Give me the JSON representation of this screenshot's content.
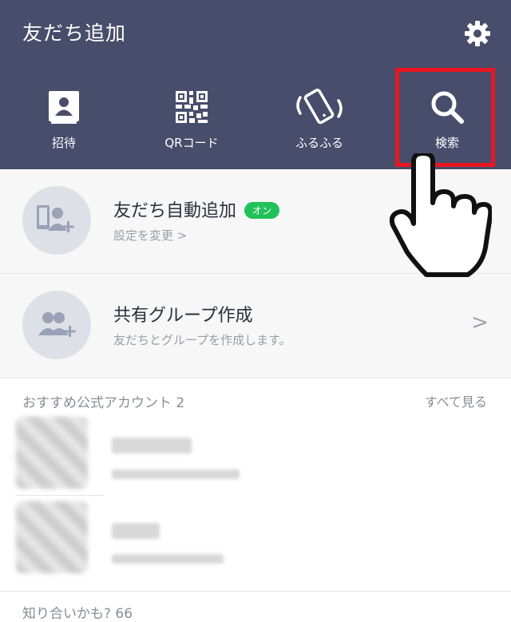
{
  "header": {
    "title": "友だち追加",
    "settings_icon": "gear-icon",
    "actions": [
      {
        "label": "招待",
        "icon": "contact-book-icon"
      },
      {
        "label": "QRコード",
        "icon": "qr-code-icon"
      },
      {
        "label": "ふるふる",
        "icon": "shake-phone-icon"
      },
      {
        "label": "検索",
        "icon": "search-icon"
      }
    ]
  },
  "rows": [
    {
      "title": "友だち自動追加",
      "badge": "オン",
      "subtitle": "設定を変更 >",
      "icon": "auto-add-friends-icon"
    },
    {
      "title": "共有グループ作成",
      "subtitle": "友だちとグループを作成します。",
      "chevron": ">",
      "icon": "create-group-icon"
    }
  ],
  "recommended": {
    "title": "おすすめ公式アカウント 2",
    "see_all": "すべて見る"
  },
  "maybe_known": {
    "title": "知り合いかも? 66"
  },
  "colors": {
    "header_bg": "#474d6a",
    "highlight": "#e8171f",
    "badge": "#21c25a"
  }
}
